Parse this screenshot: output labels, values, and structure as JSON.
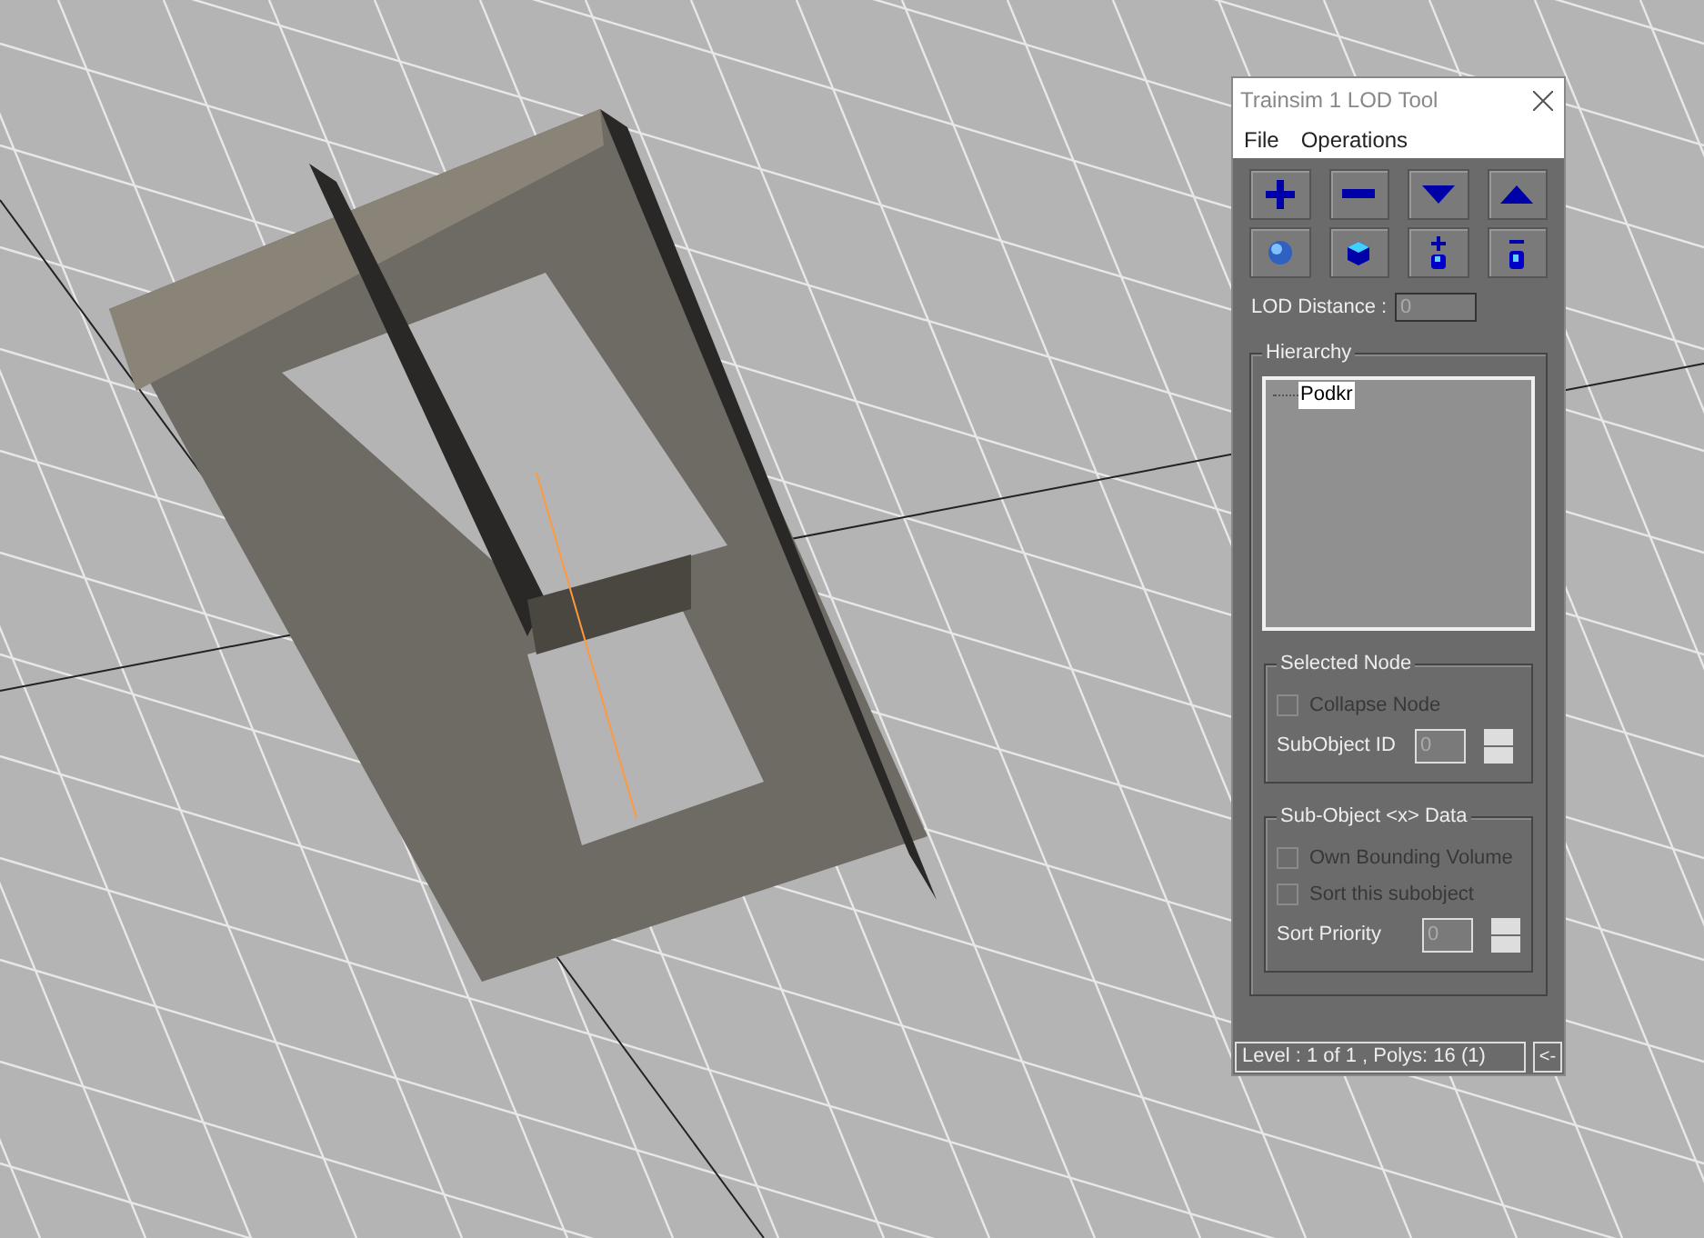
{
  "window": {
    "title": "Trainsim 1 LOD Tool"
  },
  "menu": [
    "File",
    "Operations"
  ],
  "toolbar": [
    {
      "kind": "plus"
    },
    {
      "kind": "minus"
    },
    {
      "kind": "down"
    },
    {
      "kind": "up"
    },
    {
      "kind": "sphere"
    },
    {
      "kind": "cube"
    },
    {
      "kind": "add-sub"
    },
    {
      "kind": "remove-sub"
    }
  ],
  "lod_distance": {
    "label": "LOD Distance :",
    "value": "0"
  },
  "hierarchy": {
    "title": "Hierarchy",
    "items": [
      {
        "label": "Podkr",
        "selected": true
      }
    ]
  },
  "selected_node": {
    "title": "Selected Node",
    "checks": [
      {
        "label": "Collapse Node",
        "checked": false,
        "disabled": true
      }
    ],
    "spin": {
      "label": "SubObject ID",
      "value": "0"
    }
  },
  "subobject_data": {
    "title": "Sub-Object <x> Data",
    "checks": [
      {
        "label": "Own Bounding Volume",
        "checked": false,
        "disabled": true
      },
      {
        "label": "Sort this subobject",
        "checked": false,
        "disabled": true
      }
    ],
    "spin": {
      "label": "Sort Priority",
      "value": "0"
    }
  },
  "status_bar": {
    "text": "Level : 1 of 1 , Polys: 16 (1)",
    "button": "<-"
  }
}
